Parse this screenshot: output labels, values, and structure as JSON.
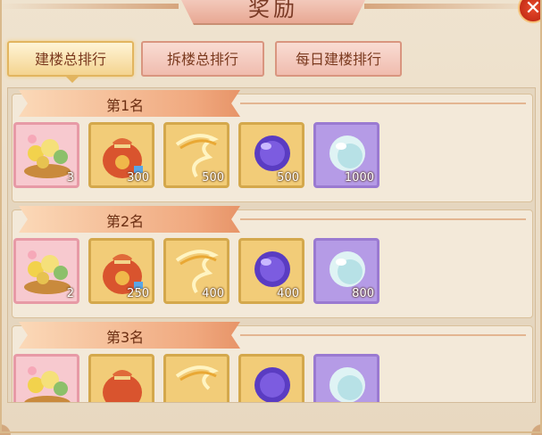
{
  "title": "奖励",
  "tabs": [
    {
      "label": "建楼总排行",
      "active": true
    },
    {
      "label": "拆楼总排行",
      "active": false
    },
    {
      "label": "每日建楼排行",
      "active": false
    }
  ],
  "ranks": [
    {
      "label": "第1名",
      "items": [
        {
          "icon": "flower-basket-icon",
          "count": "3"
        },
        {
          "icon": "gift-bag-icon",
          "count": "300"
        },
        {
          "icon": "golden-ribbon-icon",
          "count": "500"
        },
        {
          "icon": "purple-orb-icon",
          "count": "500"
        },
        {
          "icon": "pearl-orb-icon",
          "count": "1000"
        }
      ]
    },
    {
      "label": "第2名",
      "items": [
        {
          "icon": "flower-basket-icon",
          "count": "2"
        },
        {
          "icon": "gift-bag-icon",
          "count": "250"
        },
        {
          "icon": "golden-ribbon-icon",
          "count": "400"
        },
        {
          "icon": "purple-orb-icon",
          "count": "400"
        },
        {
          "icon": "pearl-orb-icon",
          "count": "800"
        }
      ]
    },
    {
      "label": "第3名",
      "items": [
        {
          "icon": "flower-basket-icon",
          "count": ""
        },
        {
          "icon": "gift-bag-icon",
          "count": ""
        },
        {
          "icon": "golden-ribbon-icon",
          "count": ""
        },
        {
          "icon": "purple-orb-icon",
          "count": ""
        },
        {
          "icon": "pearl-orb-icon",
          "count": ""
        }
      ]
    }
  ],
  "colors": {
    "title_text": "#7a3a25",
    "close_button": "#d63a1f",
    "active_tab": "#f4d48f",
    "inactive_tab": "#f0bcae"
  }
}
